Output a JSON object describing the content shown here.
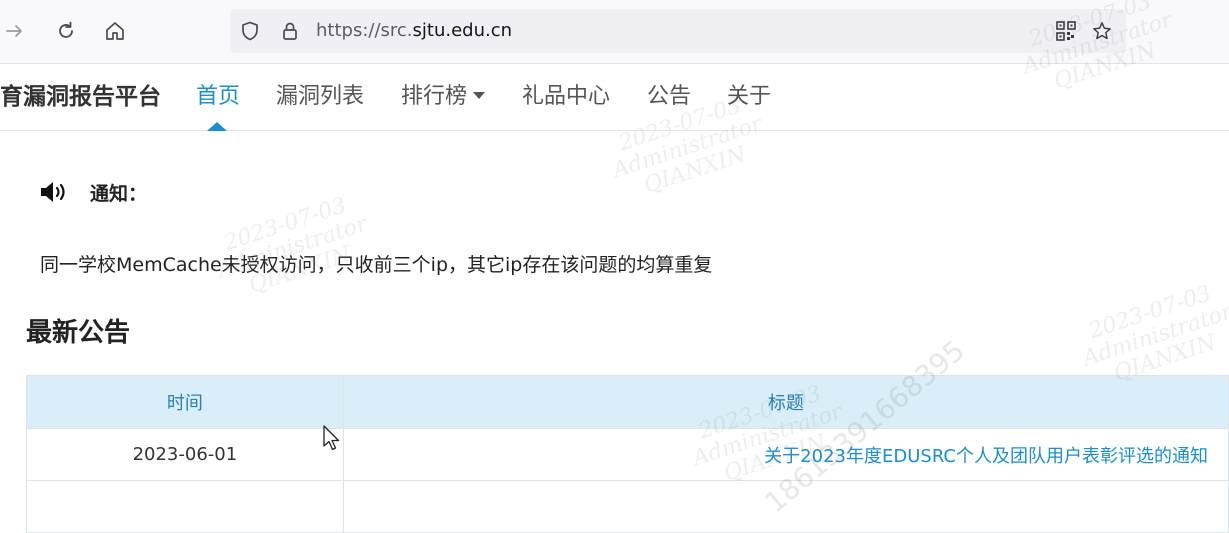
{
  "browser": {
    "url_prefix": "https://src.",
    "url_host": "sjtu.edu.cn",
    "icons": {
      "forward": "forward-arrow-icon",
      "reload": "reload-icon",
      "home": "home-icon",
      "shield": "tracking-protection-shield-icon",
      "lock": "lock-icon",
      "qr": "qr-code-icon",
      "bookmark": "bookmark-star-icon"
    }
  },
  "nav": {
    "brand": "育漏洞报告平台",
    "items": [
      {
        "label": "首页",
        "active": true
      },
      {
        "label": "漏洞列表"
      },
      {
        "label": "排行榜"
      },
      {
        "label": "礼品中心"
      },
      {
        "label": "公告"
      },
      {
        "label": "关于"
      }
    ]
  },
  "notice": {
    "title": "通知：",
    "text": "同一学校MemCache未授权访问，只收前三个ip，其它ip存在该问题的均算重复"
  },
  "announcements": {
    "heading": "最新公告",
    "columns": [
      "时间",
      "标题"
    ],
    "rows": [
      {
        "date": "2023-06-01",
        "title": "关于2023年度EDUSRC个人及团队用户表彰评选的通知"
      }
    ]
  },
  "watermark": {
    "date": "2023-07-03",
    "user": "Administrator",
    "org": "QIANXIN",
    "number": "18613391668395"
  },
  "colors": {
    "accent": "#1a8fd0",
    "table_header_bg": "#d9eef8",
    "table_header_text": "#2a7fb4"
  }
}
